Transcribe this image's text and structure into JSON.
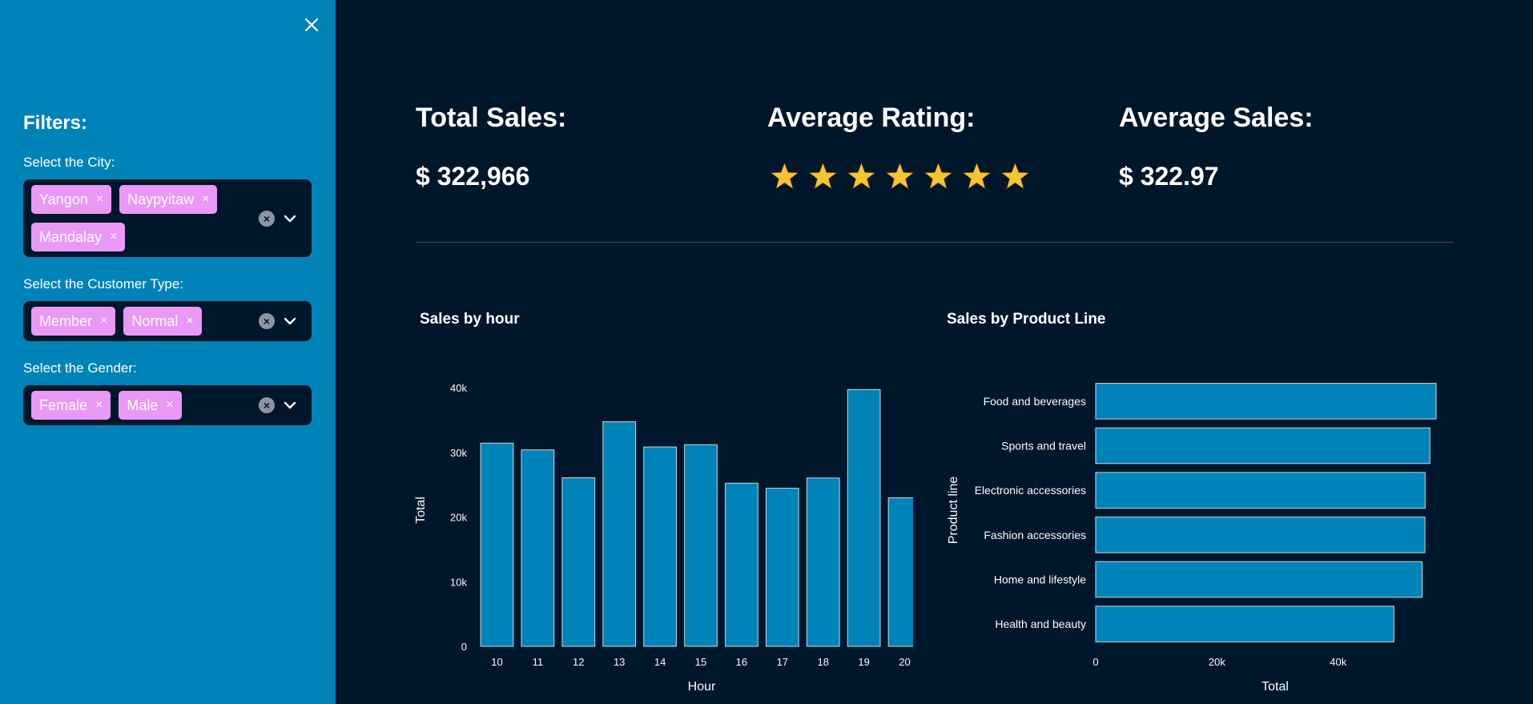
{
  "sidebar": {
    "close_icon": "close-icon",
    "filters_title": "Filters:",
    "city": {
      "label": "Select the City:",
      "tags": [
        "Yangon",
        "Naypyitaw",
        "Mandalay"
      ]
    },
    "customer_type": {
      "label": "Select the Customer Type:",
      "tags": [
        "Member",
        "Normal"
      ]
    },
    "gender": {
      "label": "Select the Gender:",
      "tags": [
        "Female",
        "Male"
      ]
    },
    "tag_remove_glyph": "×",
    "clear_glyph": "×"
  },
  "kpis": {
    "total_sales": {
      "label": "Total Sales:",
      "value": "$ 322,966"
    },
    "average_rating": {
      "label": "Average Rating:",
      "stars": 7
    },
    "average_sales": {
      "label": "Average Sales:",
      "value": "$ 322.97"
    }
  },
  "colors": {
    "sidebar": "#0083b8",
    "background": "#00172b",
    "bar": "#0083b8",
    "tag": "#ea98f5",
    "star": "#f7c331"
  },
  "chart_data": [
    {
      "type": "bar",
      "title": "Sales by hour",
      "xlabel": "Hour",
      "ylabel": "Total",
      "categories": [
        "10",
        "11",
        "12",
        "13",
        "14",
        "15",
        "16",
        "17",
        "18",
        "19",
        "20"
      ],
      "values": [
        31421,
        30377,
        26066,
        34723,
        30828,
        31180,
        25226,
        24445,
        26030,
        39700,
        22969
      ],
      "ylim": [
        0,
        40000
      ],
      "yticks": [
        "0",
        "10k",
        "20k",
        "30k",
        "40k"
      ],
      "ytick_values": [
        0,
        10000,
        20000,
        30000,
        40000
      ]
    },
    {
      "type": "bar",
      "orientation": "horizontal",
      "title": "Sales by Product Line",
      "xlabel": "Total",
      "ylabel": "Product line",
      "categories": [
        "Food and beverages",
        "Sports and travel",
        "Electronic accessories",
        "Fashion accessories",
        "Home and lifestyle",
        "Health and beauty"
      ],
      "values": [
        56145,
        55123,
        54338,
        54306,
        53862,
        49194
      ],
      "xlim": [
        0,
        56145
      ],
      "xticks": [
        "0",
        "20k",
        "40k"
      ],
      "xtick_values": [
        0,
        20000,
        40000
      ]
    }
  ]
}
